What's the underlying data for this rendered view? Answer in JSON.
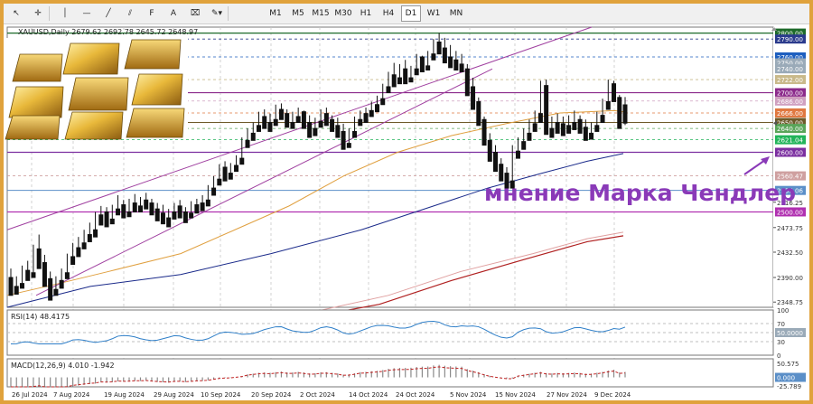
{
  "toolbar": {
    "tools": [
      {
        "name": "cursor-icon",
        "glyph": "↖"
      },
      {
        "name": "crosshair-icon",
        "glyph": "✛"
      },
      {
        "name": "vertical-line-icon",
        "glyph": "│"
      },
      {
        "name": "horizontal-line-icon",
        "glyph": "—"
      },
      {
        "name": "trendline-icon",
        "glyph": "╱"
      },
      {
        "name": "channel-icon",
        "glyph": "⫽"
      },
      {
        "name": "fibonacci-icon",
        "glyph": "F"
      },
      {
        "name": "text-icon",
        "glyph": "A"
      },
      {
        "name": "label-icon",
        "glyph": "⌧"
      },
      {
        "name": "shapes-icon",
        "glyph": "✎▾"
      }
    ],
    "timeframes": [
      "M1",
      "M5",
      "M15",
      "M30",
      "H1",
      "H4",
      "D1",
      "W1",
      "MN"
    ],
    "active_timeframe": "D1"
  },
  "symbol_header": "XAUUSD,Daily  2679.62 2692.78 2645.72 2648.97",
  "watermark_text": "мнение Марка Чендлер",
  "price_axis": {
    "ticks": [
      "2800.00",
      "2790.00",
      "2760.00",
      "2750.00",
      "2740.00",
      "2722.00",
      "2700.00",
      "2686.00",
      "2666.00",
      "2650.00",
      "2640.00",
      "2621.04",
      "2600.00",
      "2560.47",
      "2536.06",
      "2516.25",
      "2500.00",
      "2473.75",
      "2432.50",
      "2390.00",
      "2348.75"
    ],
    "highlighted": {
      "2800.00": "#1d6a2a",
      "2790.00": "#2a3a8c",
      "2760.00": "#1e5fbf",
      "2750.00": "#9aaab8",
      "2740.00": "#9aaab8",
      "2722.00": "#c9b98a",
      "2700.00": "#8b2a8b",
      "2686.00": "#cfa0c0",
      "2666.00": "#e07840",
      "2650.00": "#6e5a2a",
      "2640.00": "#5aa55a",
      "2621.04": "#22b45a",
      "2600.00": "#7b2fa0",
      "2560.47": "#cfa0a0",
      "2536.06": "#5b8fc8",
      "2500.00": "#b030b0"
    }
  },
  "rsi": {
    "label": "RSI(14) 48.4175",
    "ticks": [
      "100",
      "70",
      "50.0000",
      "30",
      "0"
    ]
  },
  "macd": {
    "label": "MACD(12,26,9) 4.010 -1.942",
    "ticks": [
      "50.575",
      "0.000",
      "-25.789"
    ]
  },
  "date_axis": [
    "26 Jul 2024",
    "7 Aug 2024",
    "19 Aug 2024",
    "29 Aug 2024",
    "10 Sep 2024",
    "20 Sep 2024",
    "2 Oct 2024",
    "14 Oct 2024",
    "24 Oct 2024",
    "5 Nov 2024",
    "15 Nov 2024",
    "27 Nov 2024",
    "9 Dec 2024"
  ],
  "colors": {
    "bull": "#1f3f8f",
    "bear": "#111111",
    "channel": "#a040a0",
    "ma_orange": "#e0a040",
    "ma_blue": "#1a2a8a",
    "ma_red": "#b02020",
    "ma_pink": "#e0a0a0",
    "rsi_line": "#2f7fc8",
    "macd_hist": "#8a8a8a",
    "macd_signal": "#c02020",
    "watermark": "#8a3ab8"
  },
  "chart_data": {
    "type": "candlestick",
    "title": "XAUUSD,Daily",
    "ylim": [
      2340,
      2810
    ],
    "x_start": "26 Jul 2024",
    "x_end": "13 Dec 2024",
    "candles": [
      [
        2390,
        2405,
        2375,
        2360
      ],
      [
        2375,
        2370,
        2392,
        2362
      ],
      [
        2380,
        2410,
        2375,
        2372
      ],
      [
        2402,
        2418,
        2390,
        2385
      ],
      [
        2398,
        2445,
        2395,
        2390
      ],
      [
        2438,
        2462,
        2410,
        2405
      ],
      [
        2415,
        2428,
        2382,
        2375
      ],
      [
        2388,
        2400,
        2360,
        2352
      ],
      [
        2370,
        2392,
        2368,
        2360
      ],
      [
        2385,
        2405,
        2380,
        2372
      ],
      [
        2398,
        2430,
        2395,
        2388
      ],
      [
        2425,
        2448,
        2420,
        2412
      ],
      [
        2440,
        2458,
        2432,
        2425
      ],
      [
        2448,
        2470,
        2445,
        2438
      ],
      [
        2462,
        2482,
        2455,
        2450
      ],
      [
        2470,
        2500,
        2465,
        2458
      ],
      [
        2495,
        2510,
        2485,
        2478
      ],
      [
        2500,
        2508,
        2482,
        2475
      ],
      [
        2488,
        2512,
        2485,
        2480
      ],
      [
        2505,
        2528,
        2502,
        2495
      ],
      [
        2512,
        2520,
        2495,
        2490
      ],
      [
        2500,
        2522,
        2498,
        2492
      ],
      [
        2515,
        2530,
        2505,
        2500
      ],
      [
        2510,
        2525,
        2508,
        2500
      ],
      [
        2520,
        2532,
        2512,
        2505
      ],
      [
        2515,
        2522,
        2500,
        2495
      ],
      [
        2505,
        2515,
        2492,
        2485
      ],
      [
        2498,
        2512,
        2485,
        2480
      ],
      [
        2490,
        2505,
        2480,
        2475
      ],
      [
        2500,
        2515,
        2495,
        2488
      ],
      [
        2510,
        2520,
        2495,
        2490
      ],
      [
        2500,
        2508,
        2490,
        2482
      ],
      [
        2498,
        2518,
        2495,
        2490
      ],
      [
        2512,
        2522,
        2505,
        2498
      ],
      [
        2515,
        2528,
        2508,
        2502
      ],
      [
        2520,
        2545,
        2515,
        2510
      ],
      [
        2540,
        2560,
        2535,
        2528
      ],
      [
        2555,
        2580,
        2550,
        2545
      ],
      [
        2575,
        2585,
        2558,
        2552
      ],
      [
        2565,
        2582,
        2562,
        2555
      ],
      [
        2578,
        2595,
        2572,
        2568
      ],
      [
        2590,
        2625,
        2585,
        2580
      ],
      [
        2620,
        2640,
        2615,
        2608
      ],
      [
        2632,
        2650,
        2625,
        2620
      ],
      [
        2645,
        2668,
        2640,
        2635
      ],
      [
        2660,
        2672,
        2645,
        2640
      ],
      [
        2650,
        2665,
        2640,
        2635
      ],
      [
        2655,
        2680,
        2650,
        2645
      ],
      [
        2672,
        2682,
        2660,
        2655
      ],
      [
        2665,
        2672,
        2648,
        2642
      ],
      [
        2650,
        2668,
        2645,
        2640
      ],
      [
        2660,
        2675,
        2655,
        2650
      ],
      [
        2668,
        2670,
        2645,
        2640
      ],
      [
        2650,
        2662,
        2630,
        2625
      ],
      [
        2640,
        2658,
        2635,
        2628
      ],
      [
        2652,
        2672,
        2648,
        2642
      ],
      [
        2665,
        2675,
        2650,
        2645
      ],
      [
        2655,
        2662,
        2640,
        2635
      ],
      [
        2645,
        2658,
        2630,
        2625
      ],
      [
        2635,
        2648,
        2610,
        2605
      ],
      [
        2615,
        2640,
        2612,
        2608
      ],
      [
        2635,
        2660,
        2630,
        2625
      ],
      [
        2655,
        2670,
        2650,
        2645
      ],
      [
        2665,
        2675,
        2655,
        2650
      ],
      [
        2670,
        2685,
        2665,
        2660
      ],
      [
        2680,
        2695,
        2672,
        2668
      ],
      [
        2690,
        2715,
        2685,
        2680
      ],
      [
        2710,
        2735,
        2705,
        2700
      ],
      [
        2730,
        2750,
        2715,
        2710
      ],
      [
        2725,
        2748,
        2720,
        2715
      ],
      [
        2740,
        2755,
        2720,
        2715
      ],
      [
        2725,
        2745,
        2722,
        2718
      ],
      [
        2740,
        2765,
        2735,
        2730
      ],
      [
        2760,
        2762,
        2740,
        2735
      ],
      [
        2745,
        2770,
        2742,
        2738
      ],
      [
        2765,
        2790,
        2760,
        2755
      ],
      [
        2785,
        2800,
        2770,
        2765
      ],
      [
        2775,
        2792,
        2755,
        2750
      ],
      [
        2760,
        2780,
        2748,
        2742
      ],
      [
        2755,
        2770,
        2742,
        2738
      ],
      [
        2748,
        2765,
        2740,
        2735
      ],
      [
        2740,
        2748,
        2700,
        2695
      ],
      [
        2710,
        2725,
        2680,
        2672
      ],
      [
        2685,
        2692,
        2650,
        2645
      ],
      [
        2655,
        2660,
        2618,
        2612
      ],
      [
        2620,
        2632,
        2590,
        2585
      ],
      [
        2600,
        2612,
        2575,
        2568
      ],
      [
        2580,
        2590,
        2560,
        2552
      ],
      [
        2565,
        2575,
        2548,
        2540
      ],
      [
        2552,
        2612,
        2548,
        2540
      ],
      [
        2602,
        2625,
        2598,
        2590
      ],
      [
        2618,
        2640,
        2612,
        2605
      ],
      [
        2632,
        2655,
        2628,
        2620
      ],
      [
        2648,
        2670,
        2642,
        2635
      ],
      [
        2665,
        2720,
        2660,
        2650
      ],
      [
        2712,
        2722,
        2690,
        2630
      ],
      [
        2640,
        2660,
        2635,
        2625
      ],
      [
        2650,
        2665,
        2640,
        2632
      ],
      [
        2648,
        2660,
        2635,
        2628
      ],
      [
        2645,
        2662,
        2640,
        2632
      ],
      [
        2650,
        2670,
        2645,
        2638
      ],
      [
        2655,
        2662,
        2640,
        2632
      ],
      [
        2642,
        2655,
        2625,
        2620
      ],
      [
        2632,
        2650,
        2628,
        2622
      ],
      [
        2645,
        2668,
        2642,
        2635
      ],
      [
        2662,
        2690,
        2658,
        2650
      ],
      [
        2685,
        2722,
        2680,
        2672
      ],
      [
        2715,
        2720,
        2690,
        2685
      ],
      [
        2692,
        2696,
        2645,
        2640
      ],
      [
        2679.62,
        2692.78,
        2645.72,
        2648.97
      ]
    ],
    "rsi_value": 48.4175,
    "macd_value": 4.01,
    "macd_signal_value": -1.942
  }
}
